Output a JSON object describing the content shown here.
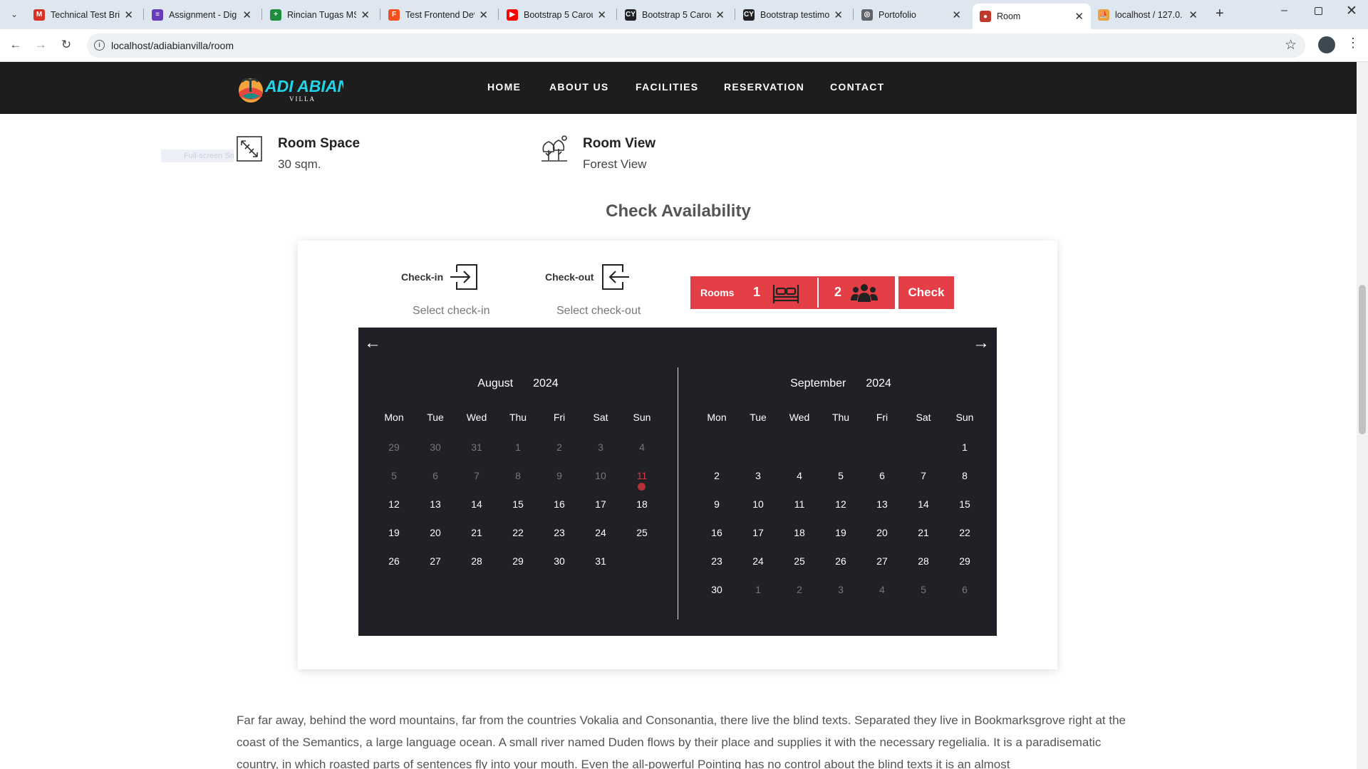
{
  "browser": {
    "tabs": [
      {
        "title": "Technical Test Brie",
        "icon": "gmail-icon",
        "color": "#d93025",
        "glyph": "M"
      },
      {
        "title": "Assignment - Dig",
        "icon": "forms-icon",
        "color": "#673ab7",
        "glyph": "≡"
      },
      {
        "title": "Rincian Tugas MS",
        "icon": "sheets-icon",
        "color": "#1e8e3e",
        "glyph": "+"
      },
      {
        "title": "Test Frontend Dev",
        "icon": "figma-icon",
        "color": "#f24e1e",
        "glyph": "F"
      },
      {
        "title": "Bootstrap 5 Carou",
        "icon": "youtube-icon",
        "color": "#ff0000",
        "glyph": "▶"
      },
      {
        "title": "Bootstrap 5 Carou",
        "icon": "cy-icon",
        "color": "#202124",
        "glyph": "CY"
      },
      {
        "title": "Bootstrap testimo",
        "icon": "cy-icon",
        "color": "#202124",
        "glyph": "CY"
      },
      {
        "title": "Portofolio",
        "icon": "globe-icon",
        "color": "#5f6368",
        "glyph": "◎"
      },
      {
        "title": "Room",
        "icon": "site-icon",
        "color": "#c0392b",
        "glyph": "●",
        "active": true
      },
      {
        "title": "localhost / 127.0.",
        "icon": "phpmyadmin-icon",
        "color": "#e8a33d",
        "glyph": "⛵"
      }
    ],
    "url": "localhost/adiabianvilla/room"
  },
  "site": {
    "logo_text": "ADI ABIAN",
    "logo_sub": "VILLA",
    "nav": [
      "HOME",
      "ABOUT US",
      "FACILITIES",
      "RESERVATION",
      "CONTACT"
    ]
  },
  "features": {
    "space": {
      "title": "Room Space",
      "value": "30 sqm."
    },
    "view": {
      "title": "Room View",
      "value": "Forest View"
    },
    "hint": "Full-screen Snip"
  },
  "availability": {
    "title": "Check Availability",
    "checkin_label": "Check-in",
    "checkin_placeholder": "Select check-in",
    "checkout_label": "Check-out",
    "checkout_placeholder": "Select check-out",
    "rooms_label": "Rooms",
    "rooms_count": "1",
    "guests_count": "2",
    "check_button": "Check"
  },
  "calendar": {
    "prev": "←",
    "next": "→",
    "weekdays": [
      "Mon",
      "Tue",
      "Wed",
      "Thu",
      "Fri",
      "Sat",
      "Sun"
    ],
    "months": [
      {
        "month": "August",
        "year": "2024",
        "days": [
          {
            "d": "29",
            "s": "dim"
          },
          {
            "d": "30",
            "s": "dim"
          },
          {
            "d": "31",
            "s": "dim"
          },
          {
            "d": "1",
            "s": "dim"
          },
          {
            "d": "2",
            "s": "dim"
          },
          {
            "d": "3",
            "s": "dim"
          },
          {
            "d": "4",
            "s": "dim"
          },
          {
            "d": "5",
            "s": "dim"
          },
          {
            "d": "6",
            "s": "dim"
          },
          {
            "d": "7",
            "s": "dim"
          },
          {
            "d": "8",
            "s": "dim"
          },
          {
            "d": "9",
            "s": "dim"
          },
          {
            "d": "10",
            "s": "dim"
          },
          {
            "d": "11",
            "s": "today"
          },
          {
            "d": "12"
          },
          {
            "d": "13"
          },
          {
            "d": "14"
          },
          {
            "d": "15"
          },
          {
            "d": "16"
          },
          {
            "d": "17"
          },
          {
            "d": "18"
          },
          {
            "d": "19"
          },
          {
            "d": "20"
          },
          {
            "d": "21"
          },
          {
            "d": "22"
          },
          {
            "d": "23"
          },
          {
            "d": "24"
          },
          {
            "d": "25"
          },
          {
            "d": "26"
          },
          {
            "d": "27"
          },
          {
            "d": "28"
          },
          {
            "d": "29"
          },
          {
            "d": "30"
          },
          {
            "d": "31"
          },
          {
            "d": ""
          }
        ]
      },
      {
        "month": "September",
        "year": "2024",
        "days": [
          {
            "d": ""
          },
          {
            "d": ""
          },
          {
            "d": ""
          },
          {
            "d": ""
          },
          {
            "d": ""
          },
          {
            "d": ""
          },
          {
            "d": "1"
          },
          {
            "d": "2"
          },
          {
            "d": "3"
          },
          {
            "d": "4"
          },
          {
            "d": "5"
          },
          {
            "d": "6"
          },
          {
            "d": "7"
          },
          {
            "d": "8"
          },
          {
            "d": "9"
          },
          {
            "d": "10"
          },
          {
            "d": "11"
          },
          {
            "d": "12"
          },
          {
            "d": "13"
          },
          {
            "d": "14"
          },
          {
            "d": "15"
          },
          {
            "d": "16"
          },
          {
            "d": "17"
          },
          {
            "d": "18"
          },
          {
            "d": "19"
          },
          {
            "d": "20"
          },
          {
            "d": "21"
          },
          {
            "d": "22"
          },
          {
            "d": "23"
          },
          {
            "d": "24"
          },
          {
            "d": "25"
          },
          {
            "d": "26"
          },
          {
            "d": "27"
          },
          {
            "d": "28"
          },
          {
            "d": "29"
          },
          {
            "d": "30"
          },
          {
            "d": "1",
            "s": "dim"
          },
          {
            "d": "2",
            "s": "dim"
          },
          {
            "d": "3",
            "s": "dim"
          },
          {
            "d": "4",
            "s": "dim"
          },
          {
            "d": "5",
            "s": "dim"
          },
          {
            "d": "6",
            "s": "dim"
          }
        ]
      }
    ]
  },
  "body_text": "Far far away, behind the word mountains, far from the countries Vokalia and Consonantia, there live the blind texts. Separated they live in Bookmarksgrove right at the coast of the Semantics, a large language ocean. A small river named Duden flows by their place and supplies it with the necessary regelialia. It is a paradisematic country, in which roasted parts of sentences fly into your mouth. Even the all-powerful Pointing has no control about the blind texts it is an almost",
  "colors": {
    "accent": "#e43f47",
    "nav_bg": "#1d1d1d",
    "calendar_bg": "#1f2126",
    "logo": "#21d4e6"
  }
}
